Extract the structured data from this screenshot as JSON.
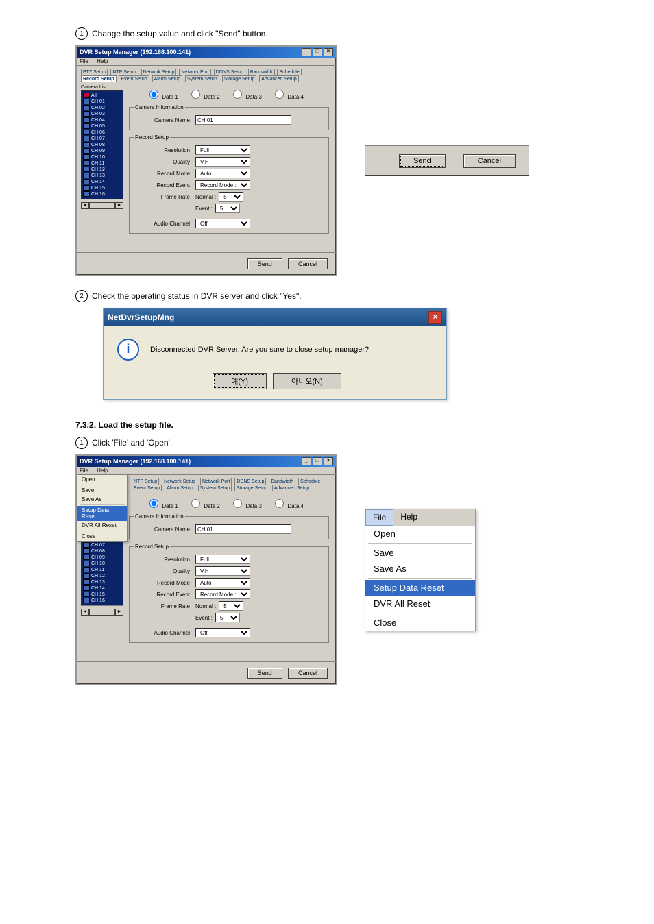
{
  "step1_title": "Change the setup value and click \"Send\" button.",
  "step2_title": "Check the operating status in DVR server and click \"Yes\".",
  "section2_heading": "7.3.2. Load the setup file.",
  "sub1_title": "Click 'File' and 'Open'.",
  "window": {
    "title": "DVR Setup Manager (192.168.100.141)",
    "menubar": {
      "file": "File",
      "help": "Help"
    },
    "tabs_row1": [
      "PTZ Setup",
      "NTP Setup",
      "Network Setup",
      "Network Port",
      "DDNS Setup",
      "Bandwidth",
      "Schedule"
    ],
    "tabs_row2": [
      "Record Setup",
      "Event Setup",
      "Alarm Setup",
      "System Setup",
      "Storage Setup",
      "Advanced Setup"
    ],
    "data_radios": [
      "Data 1",
      "Data 2",
      "Data 3",
      "Data 4"
    ],
    "camera_list_header": "Camera List",
    "cameras": [
      "All",
      "CH 01",
      "CH 02",
      "CH 03",
      "CH 04",
      "CH 05",
      "CH 06",
      "CH 07",
      "CH 08",
      "CH 09",
      "CH 10",
      "CH 11",
      "CH 12",
      "CH 13",
      "CH 14",
      "CH 15",
      "CH 16"
    ],
    "camera_info": {
      "legend": "Camera Information",
      "name_label": "Camera Name",
      "name_value": "CH 01"
    },
    "record_setup": {
      "legend": "Record Setup",
      "resolution_label": "Resolution",
      "resolution_value": "Full",
      "quality_label": "Quality",
      "quality_value": "V.H",
      "mode_label": "Record Mode",
      "mode_value": "Auto",
      "event_label": "Record Event",
      "event_value": "Record Mode : On",
      "frame_label": "Frame Rate",
      "frame_normal_label": "Normal :",
      "frame_normal_value": "5",
      "frame_event_label": "Event :",
      "frame_event_value": "5",
      "audio_label": "Audio Channel",
      "audio_value": "Off"
    },
    "buttons": {
      "send": "Send",
      "cancel": "Cancel"
    }
  },
  "sendcancel_big": {
    "send": "Send",
    "cancel": "Cancel"
  },
  "msgbox": {
    "title": "NetDvrSetupMng",
    "text": "Disconnected DVR Server, Are you sure to close setup manager?",
    "yes": "예(Y)",
    "no": "아니오(N)"
  },
  "filemenu_inline": {
    "open": "Open",
    "save": "Save",
    "saveas": "Save As",
    "sdr": "Setup Data Reset",
    "dar": "DVR All Reset",
    "close": "Close"
  },
  "menu_panel": {
    "file": "File",
    "help": "Help",
    "open": "Open",
    "save": "Save",
    "saveas": "Save As",
    "sdr": "Setup Data Reset",
    "dar": "DVR All Reset",
    "close": "Close"
  }
}
